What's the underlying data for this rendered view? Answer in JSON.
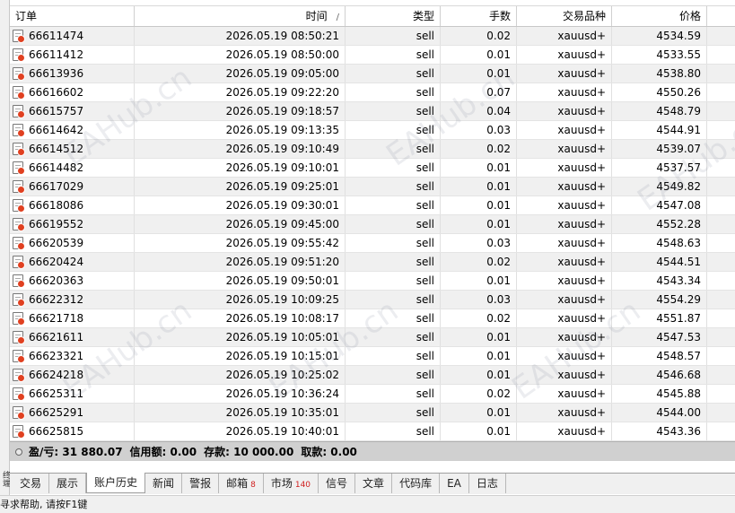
{
  "columns": {
    "order": "订单",
    "time": "时间",
    "sort_mark": "/",
    "type": "类型",
    "lots": "手数",
    "symbol": "交易品种",
    "price": "价格"
  },
  "rows": [
    {
      "order": "66611474",
      "time": "2026.05.19 08:50:21",
      "type": "sell",
      "lots": "0.02",
      "symbol": "xauusd+",
      "price": "4534.59"
    },
    {
      "order": "66611412",
      "time": "2026.05.19 08:50:00",
      "type": "sell",
      "lots": "0.01",
      "symbol": "xauusd+",
      "price": "4533.55"
    },
    {
      "order": "66613936",
      "time": "2026.05.19 09:05:00",
      "type": "sell",
      "lots": "0.01",
      "symbol": "xauusd+",
      "price": "4538.80"
    },
    {
      "order": "66616602",
      "time": "2026.05.19 09:22:20",
      "type": "sell",
      "lots": "0.07",
      "symbol": "xauusd+",
      "price": "4550.26"
    },
    {
      "order": "66615757",
      "time": "2026.05.19 09:18:57",
      "type": "sell",
      "lots": "0.04",
      "symbol": "xauusd+",
      "price": "4548.79"
    },
    {
      "order": "66614642",
      "time": "2026.05.19 09:13:35",
      "type": "sell",
      "lots": "0.03",
      "symbol": "xauusd+",
      "price": "4544.91"
    },
    {
      "order": "66614512",
      "time": "2026.05.19 09:10:49",
      "type": "sell",
      "lots": "0.02",
      "symbol": "xauusd+",
      "price": "4539.07"
    },
    {
      "order": "66614482",
      "time": "2026.05.19 09:10:01",
      "type": "sell",
      "lots": "0.01",
      "symbol": "xauusd+",
      "price": "4537.57"
    },
    {
      "order": "66617029",
      "time": "2026.05.19 09:25:01",
      "type": "sell",
      "lots": "0.01",
      "symbol": "xauusd+",
      "price": "4549.82"
    },
    {
      "order": "66618086",
      "time": "2026.05.19 09:30:01",
      "type": "sell",
      "lots": "0.01",
      "symbol": "xauusd+",
      "price": "4547.08"
    },
    {
      "order": "66619552",
      "time": "2026.05.19 09:45:00",
      "type": "sell",
      "lots": "0.01",
      "symbol": "xauusd+",
      "price": "4552.28"
    },
    {
      "order": "66620539",
      "time": "2026.05.19 09:55:42",
      "type": "sell",
      "lots": "0.03",
      "symbol": "xauusd+",
      "price": "4548.63"
    },
    {
      "order": "66620424",
      "time": "2026.05.19 09:51:20",
      "type": "sell",
      "lots": "0.02",
      "symbol": "xauusd+",
      "price": "4544.51"
    },
    {
      "order": "66620363",
      "time": "2026.05.19 09:50:01",
      "type": "sell",
      "lots": "0.01",
      "symbol": "xauusd+",
      "price": "4543.34"
    },
    {
      "order": "66622312",
      "time": "2026.05.19 10:09:25",
      "type": "sell",
      "lots": "0.03",
      "symbol": "xauusd+",
      "price": "4554.29"
    },
    {
      "order": "66621718",
      "time": "2026.05.19 10:08:17",
      "type": "sell",
      "lots": "0.02",
      "symbol": "xauusd+",
      "price": "4551.87"
    },
    {
      "order": "66621611",
      "time": "2026.05.19 10:05:01",
      "type": "sell",
      "lots": "0.01",
      "symbol": "xauusd+",
      "price": "4547.53"
    },
    {
      "order": "66623321",
      "time": "2026.05.19 10:15:01",
      "type": "sell",
      "lots": "0.01",
      "symbol": "xauusd+",
      "price": "4548.57"
    },
    {
      "order": "66624218",
      "time": "2026.05.19 10:25:02",
      "type": "sell",
      "lots": "0.01",
      "symbol": "xauusd+",
      "price": "4546.68"
    },
    {
      "order": "66625311",
      "time": "2026.05.19 10:36:24",
      "type": "sell",
      "lots": "0.02",
      "symbol": "xauusd+",
      "price": "4545.88"
    },
    {
      "order": "66625291",
      "time": "2026.05.19 10:35:01",
      "type": "sell",
      "lots": "0.01",
      "symbol": "xauusd+",
      "price": "4544.00"
    },
    {
      "order": "66625815",
      "time": "2026.05.19 10:40:01",
      "type": "sell",
      "lots": "0.01",
      "symbol": "xauusd+",
      "price": "4543.36"
    }
  ],
  "summary": {
    "profit": "盈/亏: 31 880.07",
    "credit": "信用额: 0.00",
    "deposit": "存款: 10 000.00",
    "withdrawal": "取款: 0.00"
  },
  "tabs": [
    {
      "label": "交易"
    },
    {
      "label": "展示"
    },
    {
      "label": "账户历史",
      "active": true
    },
    {
      "label": "新闻"
    },
    {
      "label": "警报"
    },
    {
      "label": "邮箱",
      "badge": "8"
    },
    {
      "label": "市场",
      "badge": "140"
    },
    {
      "label": "信号"
    },
    {
      "label": "文章"
    },
    {
      "label": "代码库"
    },
    {
      "label": "EA"
    },
    {
      "label": "日志"
    }
  ],
  "status_text": "寻求帮助, 请按F1键",
  "side_label": "终端",
  "watermarks": [
    "EAHub.cn",
    "EAHub.cn",
    "EAHub.cn",
    "EAHub.cn",
    "EAHub.cn",
    "EAHub.cn"
  ],
  "icons": {
    "row": "order-document-icon",
    "summary": "balance-dot-icon"
  },
  "colors": {
    "badge": "#d02020",
    "summary_bg": "#d0d0d0",
    "row_alt": "#f0f0f0"
  }
}
